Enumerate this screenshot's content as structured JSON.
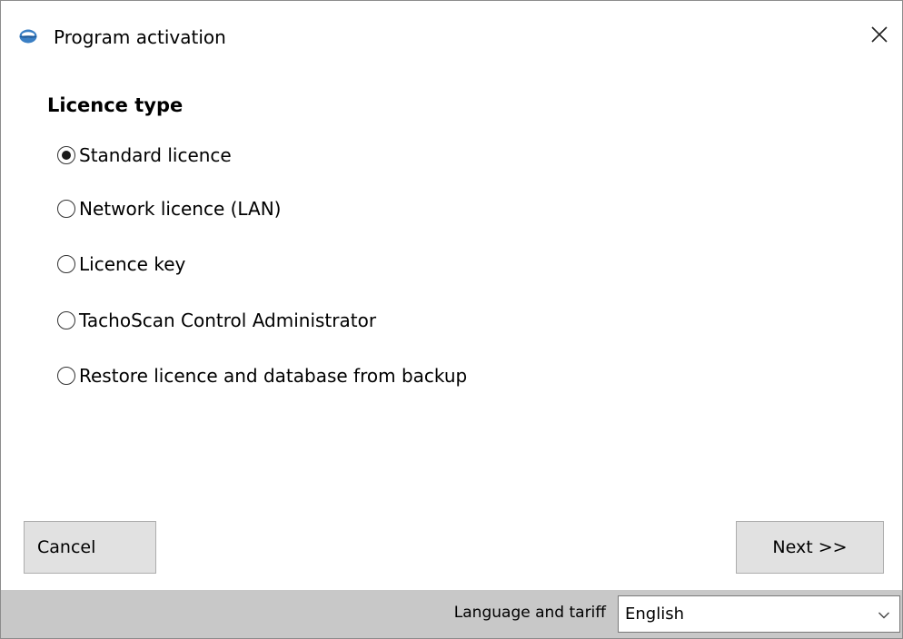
{
  "window": {
    "title": "Program activation",
    "icon": "app-globe-icon",
    "close_icon": "close-icon"
  },
  "licence": {
    "heading": "Licence type",
    "options": [
      {
        "label": "Standard licence",
        "selected": true
      },
      {
        "label": "Network licence (LAN)",
        "selected": false
      },
      {
        "label": "Licence key",
        "selected": false
      },
      {
        "label": "TachoScan Control Administrator",
        "selected": false
      },
      {
        "label": "Restore licence and database from backup",
        "selected": false
      }
    ]
  },
  "buttons": {
    "cancel": "Cancel",
    "next": "Next >>"
  },
  "footer": {
    "language_label": "Language and tariff",
    "language_value": "English"
  },
  "colors": {
    "button_bg": "#e1e1e1",
    "footer_bg": "#c8c8c8",
    "icon_blue": "#3a7fc4"
  }
}
